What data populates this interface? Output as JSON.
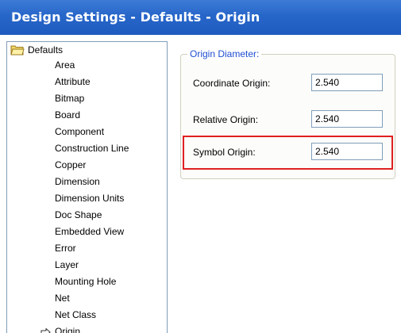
{
  "window": {
    "title": "Design Settings - Defaults - Origin"
  },
  "tree": {
    "root_label": "Defaults",
    "items": [
      {
        "label": "Area"
      },
      {
        "label": "Attribute"
      },
      {
        "label": "Bitmap"
      },
      {
        "label": "Board"
      },
      {
        "label": "Component"
      },
      {
        "label": "Construction Line"
      },
      {
        "label": "Copper"
      },
      {
        "label": "Dimension"
      },
      {
        "label": "Dimension Units"
      },
      {
        "label": "Doc Shape"
      },
      {
        "label": "Embedded View"
      },
      {
        "label": "Error"
      },
      {
        "label": "Layer"
      },
      {
        "label": "Mounting Hole"
      },
      {
        "label": "Net"
      },
      {
        "label": "Net Class"
      },
      {
        "label": "Origin",
        "selected": true
      }
    ]
  },
  "origin_diameter": {
    "group_title": "Origin Diameter:",
    "fields": [
      {
        "label": "Coordinate Origin:",
        "value": "2.540"
      },
      {
        "label": "Relative Origin:",
        "value": "2.540"
      },
      {
        "label": "Symbol Origin:",
        "value": "2.540",
        "highlighted": true
      }
    ]
  },
  "colors": {
    "title_bar": "#2766c9",
    "group_title": "#1f4fd0",
    "highlight": "#e02020"
  }
}
